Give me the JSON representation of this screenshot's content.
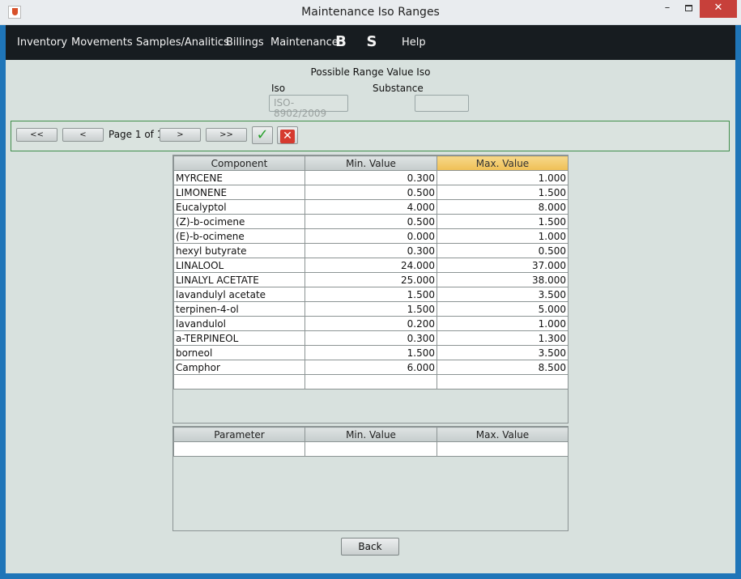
{
  "window": {
    "title": "Maintenance Iso Ranges",
    "minimize": "–",
    "close": "✕"
  },
  "menu": {
    "items": [
      "Inventory",
      "Movements",
      "Samples/Analitics",
      "Billings",
      "Maintenance",
      "Help"
    ],
    "icon_b": "B",
    "icon_s": "S"
  },
  "form": {
    "title": "Possible Range Value Iso",
    "iso_label": "Iso",
    "iso_value": "ISO-8902/2009",
    "substance_label": "Substance",
    "substance_value": ""
  },
  "nav": {
    "first": "<<",
    "prev": "<",
    "page_label": "Page 1 of 1",
    "next": ">",
    "last": ">>",
    "ok_symbol": "✓",
    "cancel_symbol": "✕"
  },
  "components_table": {
    "headers": [
      "Component",
      "Min. Value",
      "Max. Value"
    ],
    "rows": [
      {
        "component": "MYRCENE",
        "min": "0.300",
        "max": "1.000"
      },
      {
        "component": "LIMONENE",
        "min": "0.500",
        "max": "1.500"
      },
      {
        "component": "Eucalyptol",
        "min": "4.000",
        "max": "8.000"
      },
      {
        "component": "(Z)-b-ocimene",
        "min": "0.500",
        "max": "1.500"
      },
      {
        "component": "(E)-b-ocimene",
        "min": "0.000",
        "max": "1.000"
      },
      {
        "component": "hexyl butyrate",
        "min": "0.300",
        "max": "0.500"
      },
      {
        "component": "LINALOOL",
        "min": "24.000",
        "max": "37.000"
      },
      {
        "component": "LINALYL ACETATE",
        "min": "25.000",
        "max": "38.000"
      },
      {
        "component": "lavandulyl acetate",
        "min": "1.500",
        "max": "3.500"
      },
      {
        "component": "terpinen-4-ol",
        "min": "1.500",
        "max": "5.000"
      },
      {
        "component": "lavandulol",
        "min": "0.200",
        "max": "1.000"
      },
      {
        "component": "a-TERPINEOL",
        "min": "0.300",
        "max": "1.300"
      },
      {
        "component": "borneol",
        "min": "1.500",
        "max": "3.500"
      },
      {
        "component": "Camphor",
        "min": "6.000",
        "max": "8.500"
      },
      {
        "component": "",
        "min": "",
        "max": ""
      }
    ]
  },
  "parameters_table": {
    "headers": [
      "Parameter",
      "Min. Value",
      "Max. Value"
    ],
    "rows": [
      {
        "parameter": "",
        "min": "",
        "max": ""
      }
    ]
  },
  "footer": {
    "back_label": "Back"
  }
}
